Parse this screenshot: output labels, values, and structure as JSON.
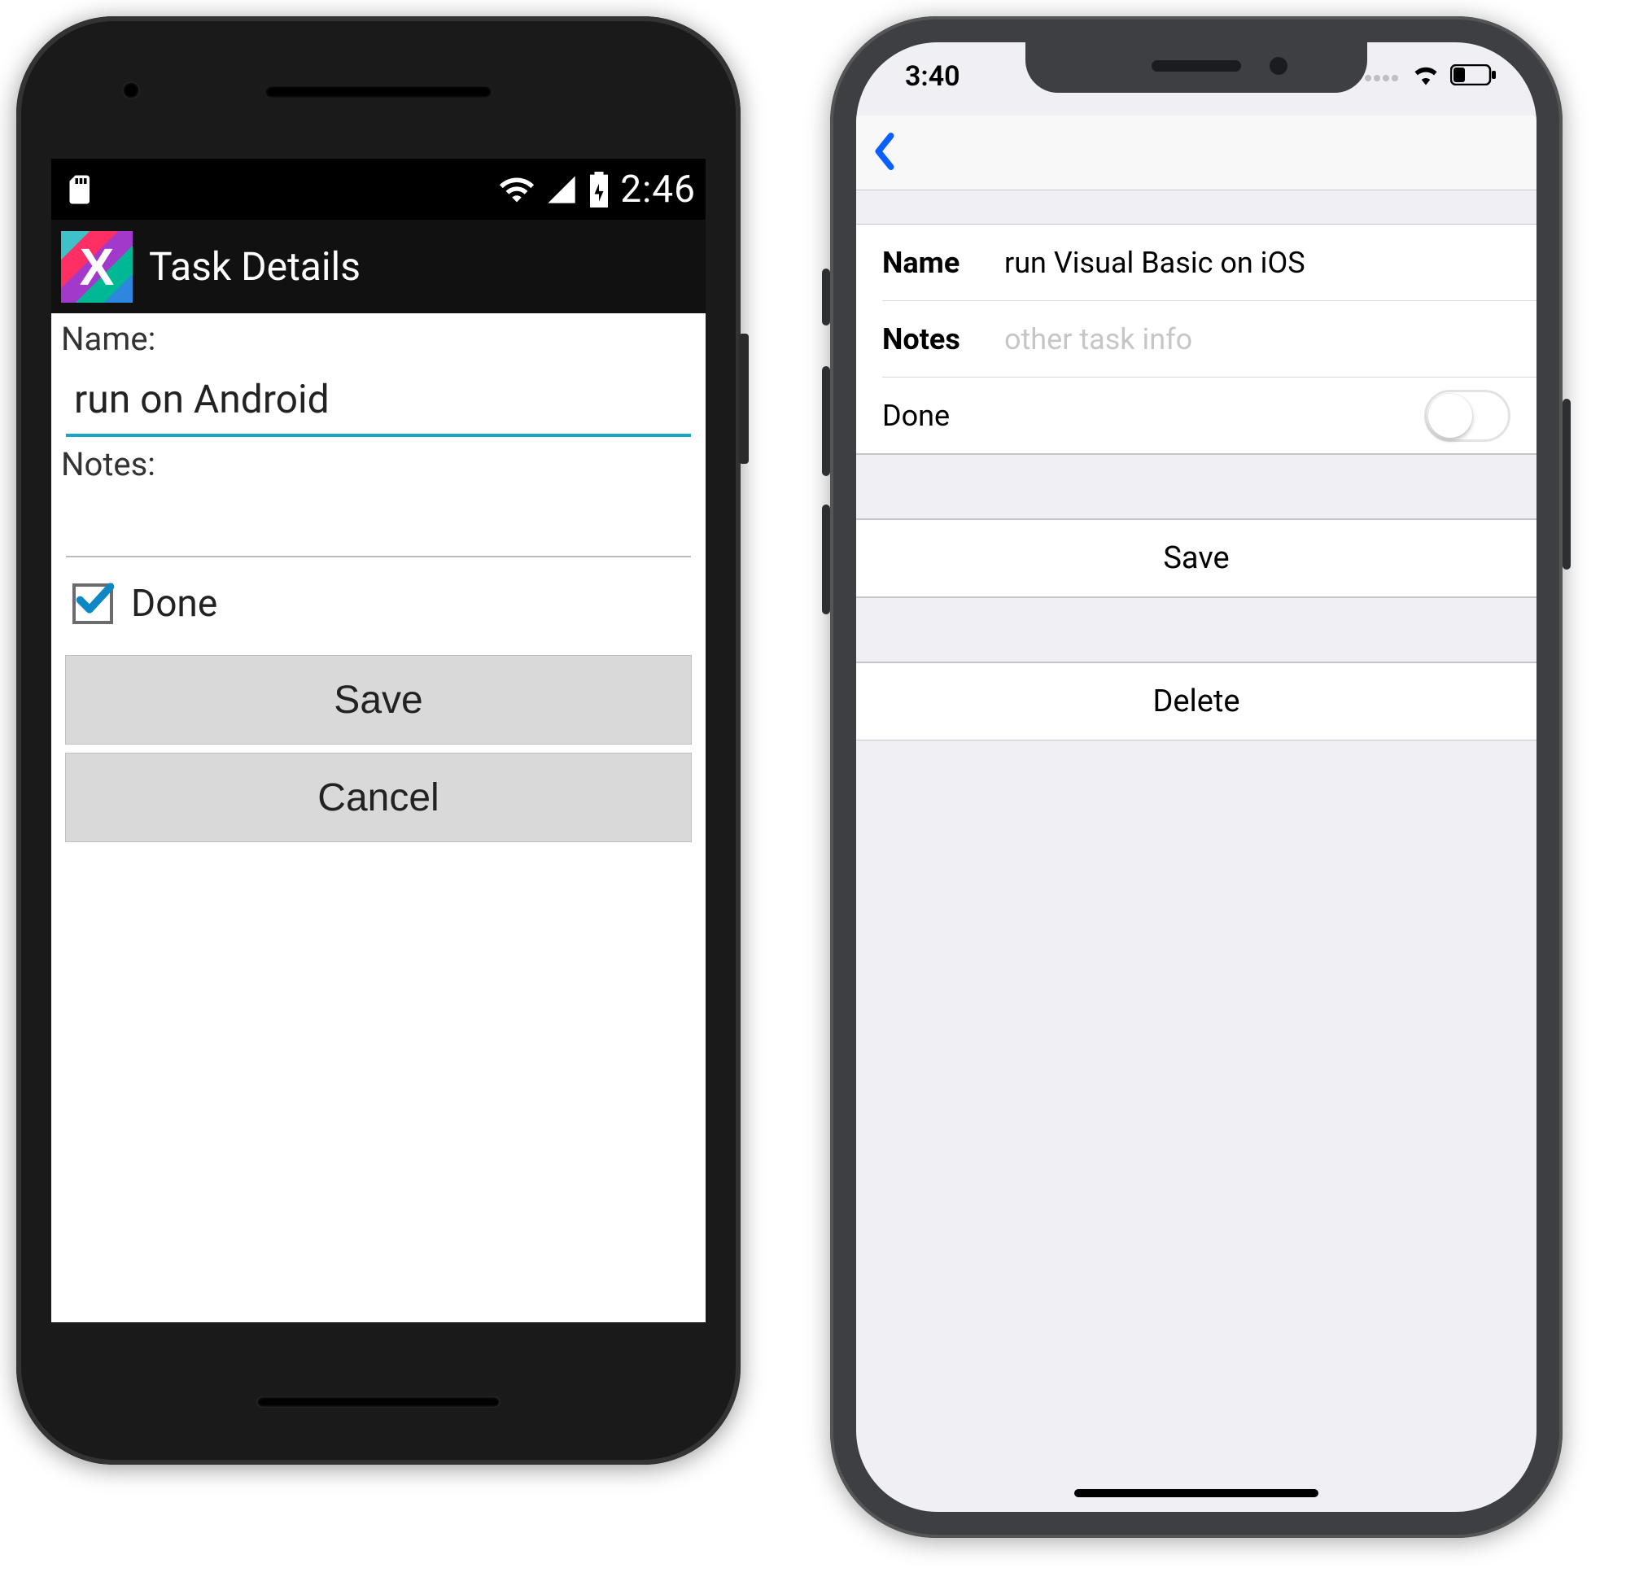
{
  "android": {
    "status": {
      "time": "2:46"
    },
    "actionbar": {
      "title": "Task Details"
    },
    "form": {
      "name_label": "Name:",
      "name_value": "run on Android",
      "notes_label": "Notes:",
      "notes_value": "",
      "done_label": "Done",
      "done_checked": true,
      "save_label": "Save",
      "cancel_label": "Cancel"
    }
  },
  "ios": {
    "status": {
      "time": "3:40"
    },
    "form": {
      "name_label": "Name",
      "name_value": "run Visual Basic on iOS",
      "notes_label": "Notes",
      "notes_placeholder": "other task info",
      "done_label": "Done",
      "done_on": false,
      "save_label": "Save",
      "delete_label": "Delete"
    }
  }
}
